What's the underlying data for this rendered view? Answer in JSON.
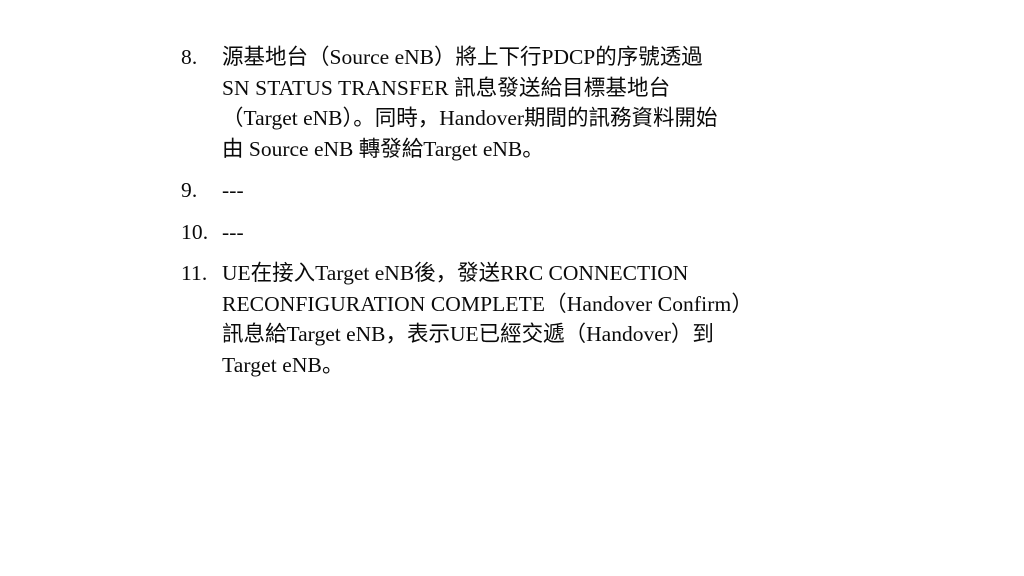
{
  "slide": {
    "background_color": "#ffffff",
    "text_color": "#0a0a0a",
    "list": [
      {
        "marker": "8.",
        "lines": [
          "源基地台（Source eNB）將上下行PDCP的序號透過",
          "SN STATUS TRANSFER 訊息發送給目標基地台",
          "（Target eNB）。同時，Handover期間的訊務資料開始",
          "由 Source eNB 轉發給Target eNB。"
        ]
      },
      {
        "marker": "9.",
        "lines": [
          "---"
        ]
      },
      {
        "marker": "10.",
        "lines": [
          "---"
        ]
      },
      {
        "marker": "11.",
        "lines": [
          "UE在接入Target eNB後，發送RRC CONNECTION",
          "RECONFIGURATION COMPLETE（Handover Confirm）",
          "訊息給Target eNB，表示UE已經交遞（Handover）到",
          "Target eNB。"
        ]
      }
    ]
  }
}
